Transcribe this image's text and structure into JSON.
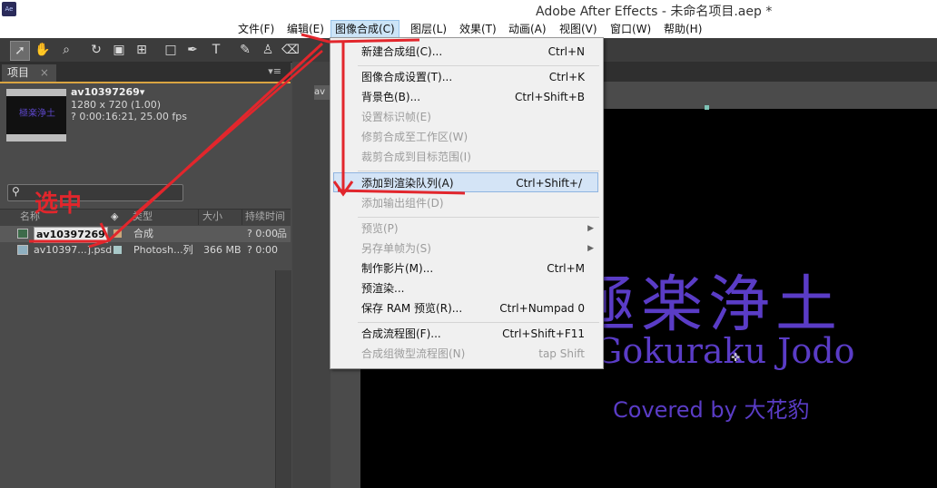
{
  "window": {
    "app_icon": "Ae",
    "title": "Adobe After Effects - 未命名项目.aep *"
  },
  "menubar": {
    "items": [
      "文件(F)",
      "编辑(E)",
      "图像合成(C)",
      "图层(L)",
      "效果(T)",
      "动画(A)",
      "视图(V)",
      "窗口(W)",
      "帮助(H)"
    ],
    "active_index": 2
  },
  "project_panel": {
    "tab_label": "项目",
    "tab_close": "×",
    "panel_menu": "▾≡",
    "thumbnail_text": "極楽浄土",
    "comp": {
      "name": "av10397269▾",
      "resolution": "1280 x 720 (1.00)",
      "duration": "? 0:00:16:21, 25.00 fps"
    },
    "search_placeholder": "",
    "columns": [
      "名称",
      "类型",
      "大小",
      "持续时间"
    ],
    "rows": [
      {
        "name": "av10397269",
        "type": "合成",
        "size": "",
        "duration": "? 0:00",
        "label_color": "#c9a77b",
        "selected": true
      },
      {
        "name": "av10397...].psd",
        "type": "Photosh...列",
        "size": "366 MB",
        "duration": "? 0:00",
        "label_color": "#a8c8c8",
        "selected": false
      }
    ]
  },
  "viewer": {
    "tab_fragment": "av",
    "title_jp": "極楽浄土",
    "title_romaji": "Gokuraku Jodo",
    "credit": "Covered by 大花豹"
  },
  "dropdown": {
    "items": [
      {
        "label": "新建合成组(C)...",
        "shortcut": "Ctrl+N",
        "disabled": false
      },
      {
        "sep": true
      },
      {
        "label": "图像合成设置(T)...",
        "shortcut": "Ctrl+K",
        "disabled": false
      },
      {
        "label": "背景色(B)...",
        "shortcut": "Ctrl+Shift+B",
        "disabled": false
      },
      {
        "label": "设置标识帧(E)",
        "shortcut": "",
        "disabled": true
      },
      {
        "label": "修剪合成至工作区(W)",
        "shortcut": "",
        "disabled": true
      },
      {
        "label": "裁剪合成到目标范围(I)",
        "shortcut": "",
        "disabled": true
      },
      {
        "sep": true
      },
      {
        "label": "添加到渲染队列(A)",
        "shortcut": "Ctrl+Shift+/",
        "disabled": false,
        "highlighted": true
      },
      {
        "label": "添加输出组件(D)",
        "shortcut": "",
        "disabled": true
      },
      {
        "sep": true
      },
      {
        "label": "预览(P)",
        "shortcut": "",
        "disabled": true,
        "submenu": true
      },
      {
        "label": "另存单帧为(S)",
        "shortcut": "",
        "disabled": true,
        "submenu": true
      },
      {
        "label": "制作影片(M)...",
        "shortcut": "Ctrl+M",
        "disabled": false
      },
      {
        "label": "预渲染...",
        "shortcut": "",
        "disabled": false
      },
      {
        "label": "保存 RAM 预览(R)...",
        "shortcut": "Ctrl+Numpad 0",
        "disabled": false
      },
      {
        "sep": true
      },
      {
        "label": "合成流程图(F)...",
        "shortcut": "Ctrl+Shift+F11",
        "disabled": false
      },
      {
        "label": "合成组微型流程图(N)",
        "shortcut": "tap Shift",
        "disabled": true
      }
    ]
  },
  "annotation": {
    "text": "选中",
    "color": "#e2262c"
  }
}
